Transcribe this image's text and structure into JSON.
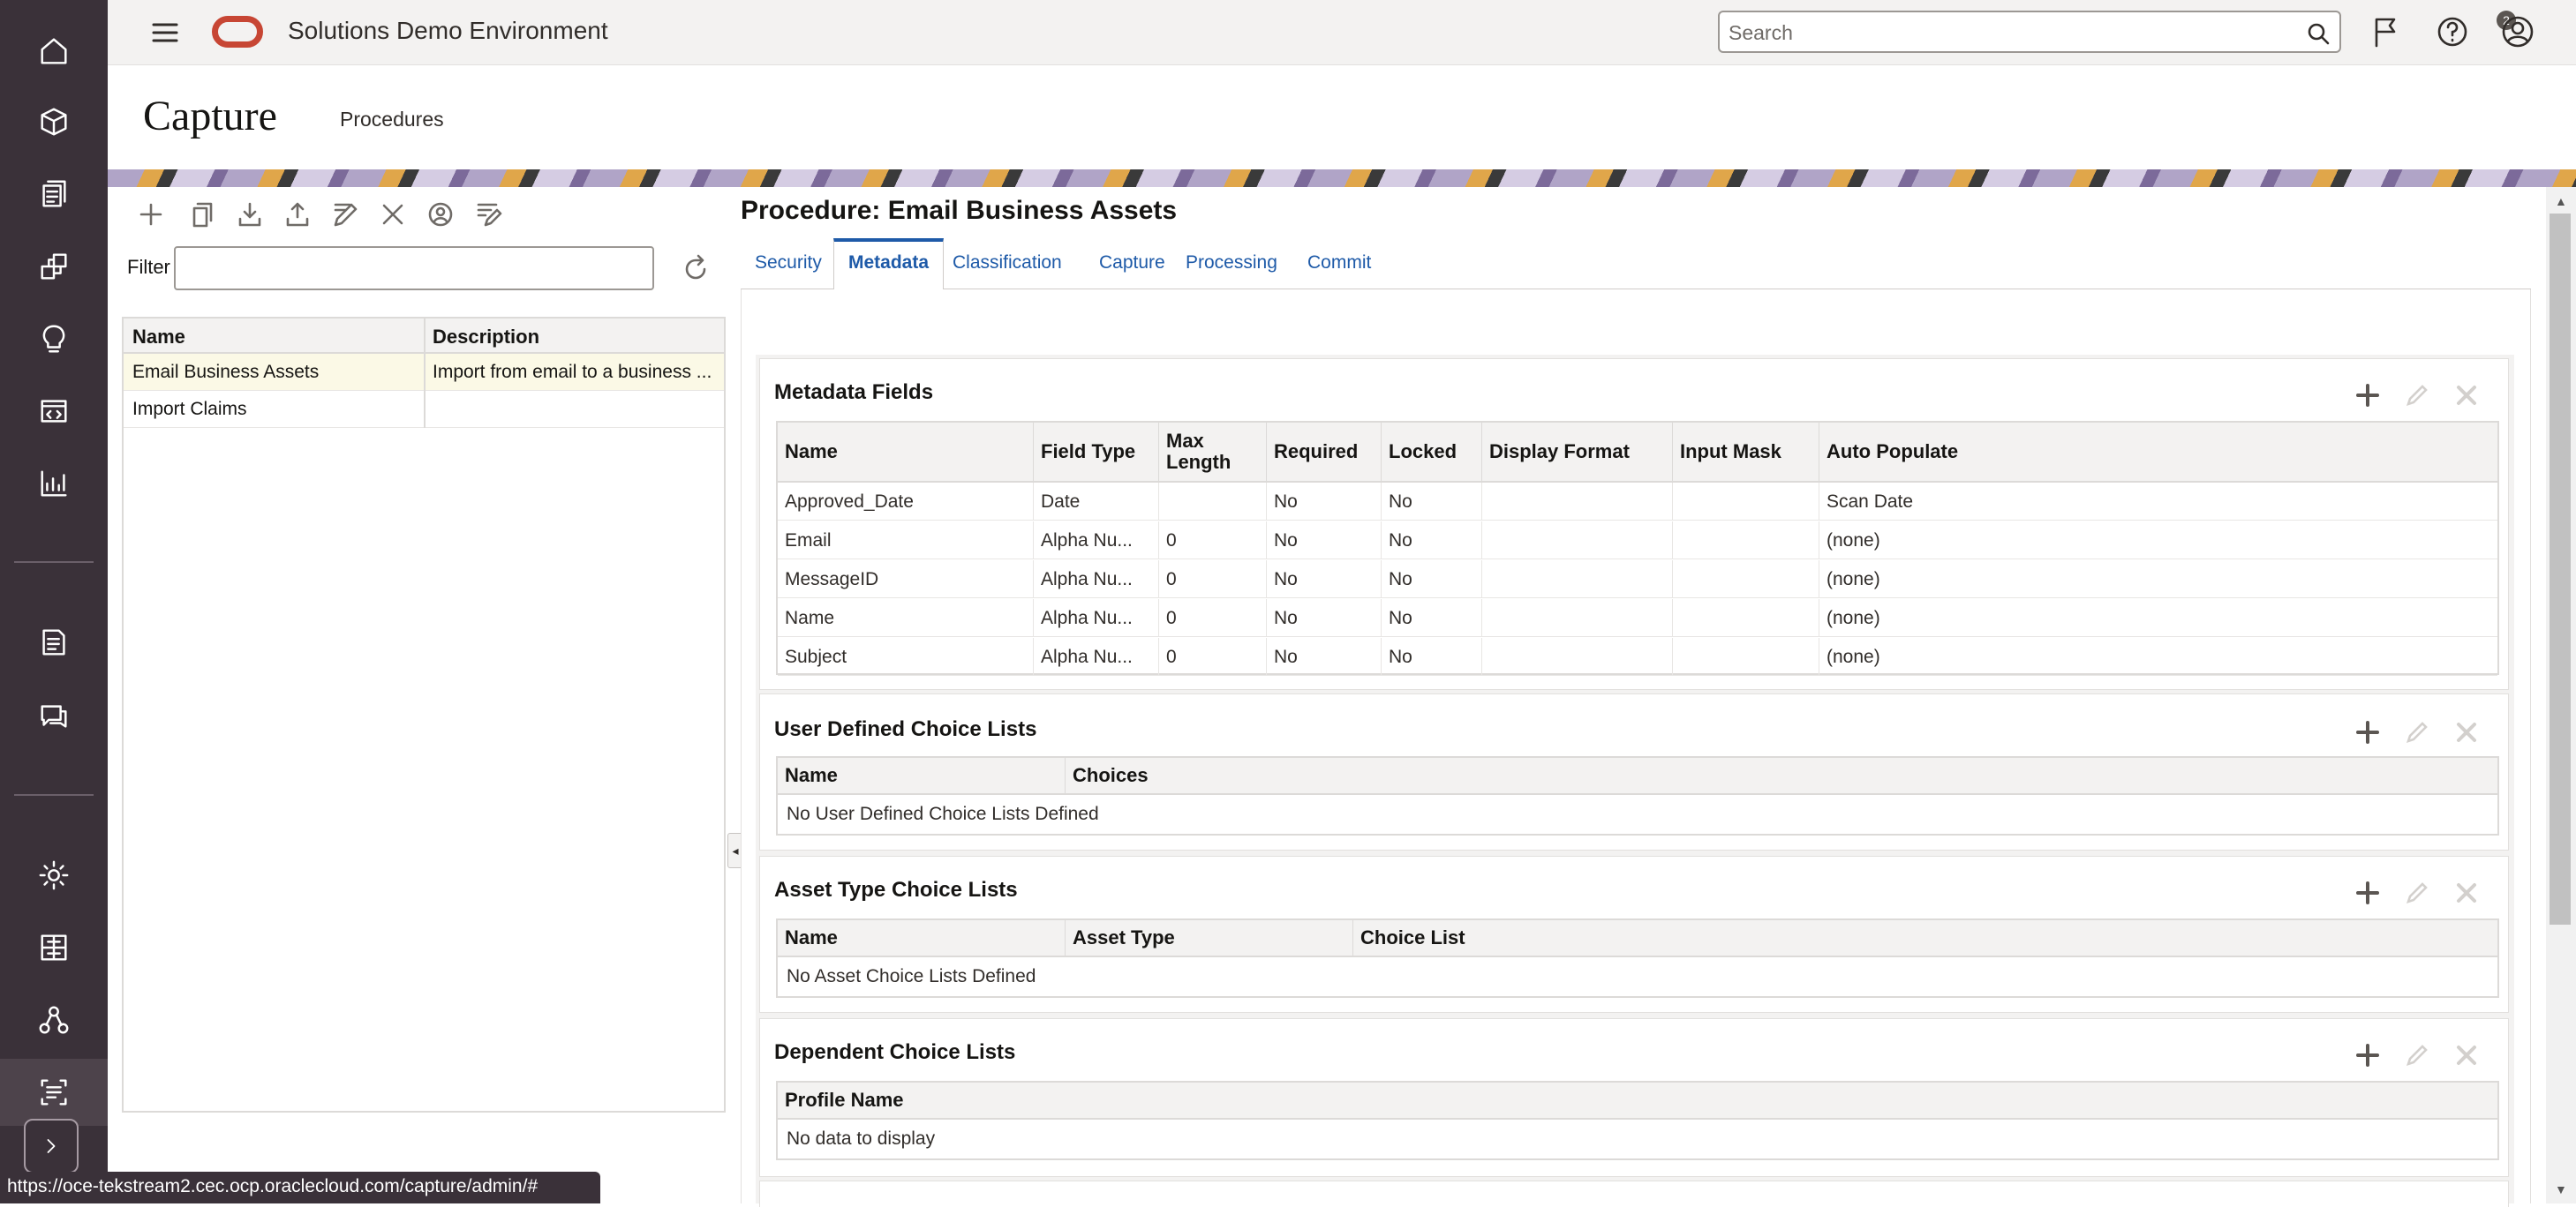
{
  "app": {
    "title": "Solutions Demo Environment",
    "search_placeholder": "Search",
    "notification_count": "2",
    "accent_color": "#c74634"
  },
  "sidebar": {
    "top_icons": [
      "home-icon",
      "cube-icon",
      "documents-icon",
      "sites-icon",
      "lightbulb-icon",
      "code-window-icon",
      "analytics-icon"
    ],
    "mid_icons": [
      "document-icon",
      "conversations-icon"
    ],
    "bottom_icons": [
      "settings-icon",
      "integrations-icon",
      "org-icon",
      "capture-icon"
    ]
  },
  "page": {
    "title": "Capture",
    "subtitle": "Procedures"
  },
  "left": {
    "filter_label": "Filter",
    "filter_value": "",
    "table": {
      "headers": [
        "Name",
        "Description"
      ],
      "rows": [
        {
          "name": "Email Business Assets",
          "description": "Import from email to a business ..."
        },
        {
          "name": "Import Claims",
          "description": ""
        }
      ]
    }
  },
  "procedure": {
    "title": "Procedure: Email Business Assets",
    "tabs": [
      "Security",
      "Metadata",
      "Classification",
      "Capture",
      "Processing",
      "Commit"
    ],
    "selected_tab": "Metadata"
  },
  "metadata_fields": {
    "title": "Metadata Fields",
    "headers": [
      "Name",
      "Field Type",
      "Max Length",
      "Required",
      "Locked",
      "Display Format",
      "Input Mask",
      "Auto Populate"
    ],
    "rows": [
      [
        "Approved_Date",
        "Date",
        "",
        "No",
        "No",
        "",
        "",
        "Scan Date"
      ],
      [
        "Email",
        "Alpha Nu...",
        "0",
        "No",
        "No",
        "",
        "",
        "(none)"
      ],
      [
        "MessageID",
        "Alpha Nu...",
        "0",
        "No",
        "No",
        "",
        "",
        "(none)"
      ],
      [
        "Name",
        "Alpha Nu...",
        "0",
        "No",
        "No",
        "",
        "",
        "(none)"
      ],
      [
        "Subject",
        "Alpha Nu...",
        "0",
        "No",
        "No",
        "",
        "",
        "(none)"
      ]
    ]
  },
  "user_defined": {
    "title": "User Defined Choice Lists",
    "headers": [
      "Name",
      "Choices"
    ],
    "empty": "No User Defined Choice Lists Defined"
  },
  "asset_type": {
    "title": "Asset Type Choice Lists",
    "headers": [
      "Name",
      "Asset Type",
      "Choice List"
    ],
    "empty": "No Asset Choice Lists Defined"
  },
  "dependent": {
    "title": "Dependent Choice Lists",
    "headers": [
      "Profile Name"
    ],
    "empty": "No data to display"
  },
  "status_url": "https://oce-tekstream2.cec.ocp.oraclecloud.com/capture/admin/#"
}
